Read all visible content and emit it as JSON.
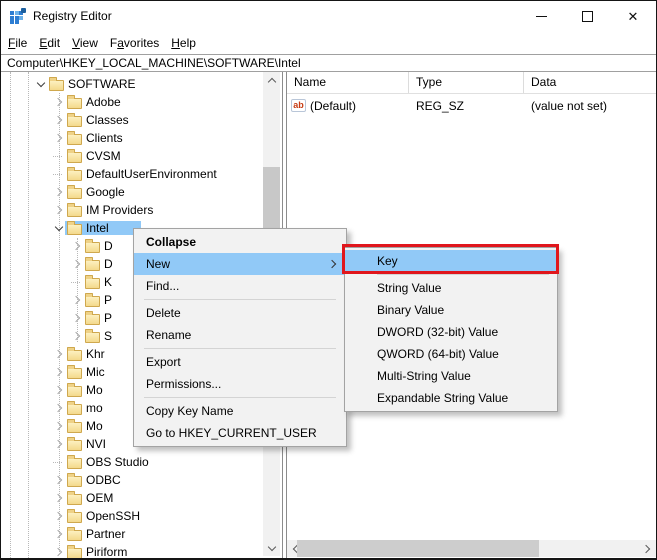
{
  "window": {
    "title": "Registry Editor"
  },
  "titlebar_controls": {
    "minimize": "minimize",
    "maximize": "maximize",
    "close": "close"
  },
  "menubar": {
    "items": [
      {
        "pre": "",
        "key": "F",
        "post": "ile"
      },
      {
        "pre": "",
        "key": "E",
        "post": "dit"
      },
      {
        "pre": "",
        "key": "V",
        "post": "iew"
      },
      {
        "pre": "F",
        "key": "a",
        "post": "vorites"
      },
      {
        "pre": "",
        "key": "H",
        "post": "elp"
      }
    ]
  },
  "addressbar": {
    "value": "Computer\\HKEY_LOCAL_MACHINE\\SOFTWARE\\Intel"
  },
  "tree": {
    "items": [
      {
        "label": "SOFTWARE"
      },
      {
        "label": "Adobe"
      },
      {
        "label": "Classes"
      },
      {
        "label": "Clients"
      },
      {
        "label": "CVSM"
      },
      {
        "label": "DefaultUserEnvironment"
      },
      {
        "label": "Google"
      },
      {
        "label": "IM Providers"
      },
      {
        "label": "Intel"
      },
      {
        "label": "D"
      },
      {
        "label": "D"
      },
      {
        "label": "K"
      },
      {
        "label": "P"
      },
      {
        "label": "P"
      },
      {
        "label": "S"
      },
      {
        "label": "Khr"
      },
      {
        "label": "Mic"
      },
      {
        "label": "Mo"
      },
      {
        "label": "mo"
      },
      {
        "label": "Mo"
      },
      {
        "label": "NVI"
      },
      {
        "label": "OBS Studio"
      },
      {
        "label": "ODBC"
      },
      {
        "label": "OEM"
      },
      {
        "label": "OpenSSH"
      },
      {
        "label": "Partner"
      },
      {
        "label": "Piriform"
      }
    ]
  },
  "list": {
    "columns": [
      {
        "label": "Name"
      },
      {
        "label": "Type"
      },
      {
        "label": "Data"
      }
    ],
    "rows": [
      {
        "name": "(Default)",
        "type": "REG_SZ",
        "data": "(value not set)"
      }
    ],
    "ab_icon_text": "ab"
  },
  "context_menu": {
    "items": [
      {
        "label": "Collapse"
      },
      {
        "label": "New"
      },
      {
        "label": "Find..."
      },
      {
        "label": "Delete"
      },
      {
        "label": "Rename"
      },
      {
        "label": "Export"
      },
      {
        "label": "Permissions..."
      },
      {
        "label": "Copy Key Name"
      },
      {
        "label": "Go to HKEY_CURRENT_USER"
      }
    ]
  },
  "submenu": {
    "items": [
      {
        "label": "Key"
      },
      {
        "label": "String Value"
      },
      {
        "label": "Binary Value"
      },
      {
        "label": "DWORD (32-bit) Value"
      },
      {
        "label": "QWORD (64-bit) Value"
      },
      {
        "label": "Multi-String Value"
      },
      {
        "label": "Expandable String Value"
      }
    ]
  },
  "colors": {
    "selection": "#91c9f7",
    "annotation": "#e0161c",
    "folder_body": "#f7e097",
    "folder_edge": "#cfa84e",
    "ab_icon_red": "#c63a12"
  }
}
